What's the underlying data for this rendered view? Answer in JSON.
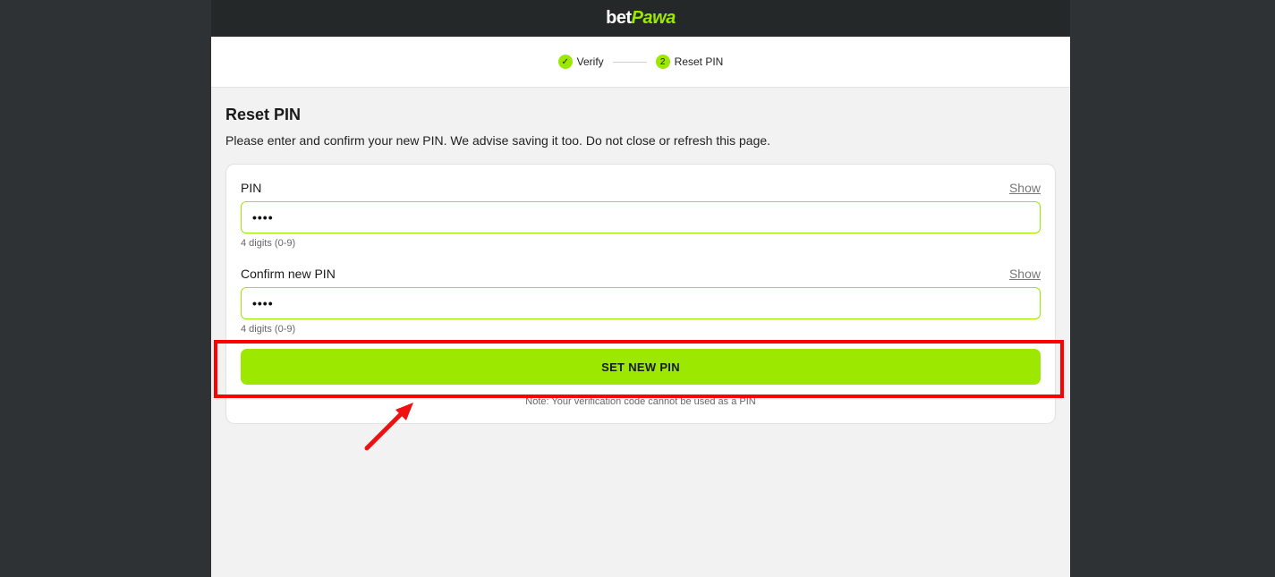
{
  "header": {
    "logo_part1": "bet",
    "logo_part2": "Pawa"
  },
  "stepper": {
    "steps": [
      {
        "label": "Verify",
        "marker": "✓"
      },
      {
        "label": "Reset PIN",
        "marker": "2"
      }
    ]
  },
  "main": {
    "title": "Reset PIN",
    "subtitle": "Please enter and confirm your new PIN. We advise saving it too. Do not close or refresh this page."
  },
  "form": {
    "pin": {
      "label": "PIN",
      "show_label": "Show",
      "value": "••••",
      "hint": "4 digits (0-9)"
    },
    "confirm_pin": {
      "label": "Confirm new PIN",
      "show_label": "Show",
      "value": "••••",
      "hint": "4 digits (0-9)"
    },
    "submit_label": "SET NEW PIN",
    "note": "Note: Your verification code cannot be used as a PIN"
  },
  "colors": {
    "accent": "#9ce800",
    "highlight": "#ff0000",
    "topbar": "#252829",
    "backdrop": "#2e3235"
  }
}
